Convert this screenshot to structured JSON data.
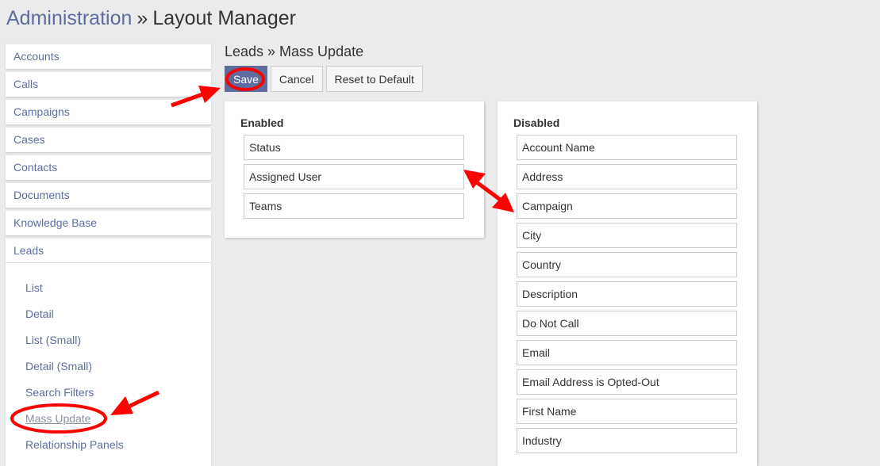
{
  "header": {
    "breadcrumb_root": "Administration",
    "separator": "»",
    "title": "Layout Manager"
  },
  "sidebar": {
    "items": [
      {
        "label": "Accounts"
      },
      {
        "label": "Calls"
      },
      {
        "label": "Campaigns"
      },
      {
        "label": "Cases"
      },
      {
        "label": "Contacts"
      },
      {
        "label": "Documents"
      },
      {
        "label": "Knowledge Base"
      }
    ],
    "expanded_group": {
      "label": "Leads",
      "sub_items": [
        {
          "label": "List"
        },
        {
          "label": "Detail"
        },
        {
          "label": "List (Small)"
        },
        {
          "label": "Detail (Small)"
        },
        {
          "label": "Search Filters"
        },
        {
          "label": "Mass Update",
          "active": true
        },
        {
          "label": "Relationship Panels"
        }
      ]
    }
  },
  "main": {
    "title": "Leads » Mass Update",
    "toolbar": {
      "save_label": "Save",
      "cancel_label": "Cancel",
      "reset_label": "Reset to Default"
    },
    "enabled": {
      "label": "Enabled",
      "fields": [
        "Status",
        "Assigned User",
        "Teams"
      ]
    },
    "disabled": {
      "label": "Disabled",
      "fields": [
        "Account Name",
        "Address",
        "Campaign",
        "City",
        "Country",
        "Description",
        "Do Not Call",
        "Email",
        "Email Address is Opted-Out",
        "First Name",
        "Industry"
      ]
    }
  },
  "colors": {
    "accent": "#5d6e9e",
    "annotation": "#ff0000",
    "background": "#ebebeb"
  }
}
